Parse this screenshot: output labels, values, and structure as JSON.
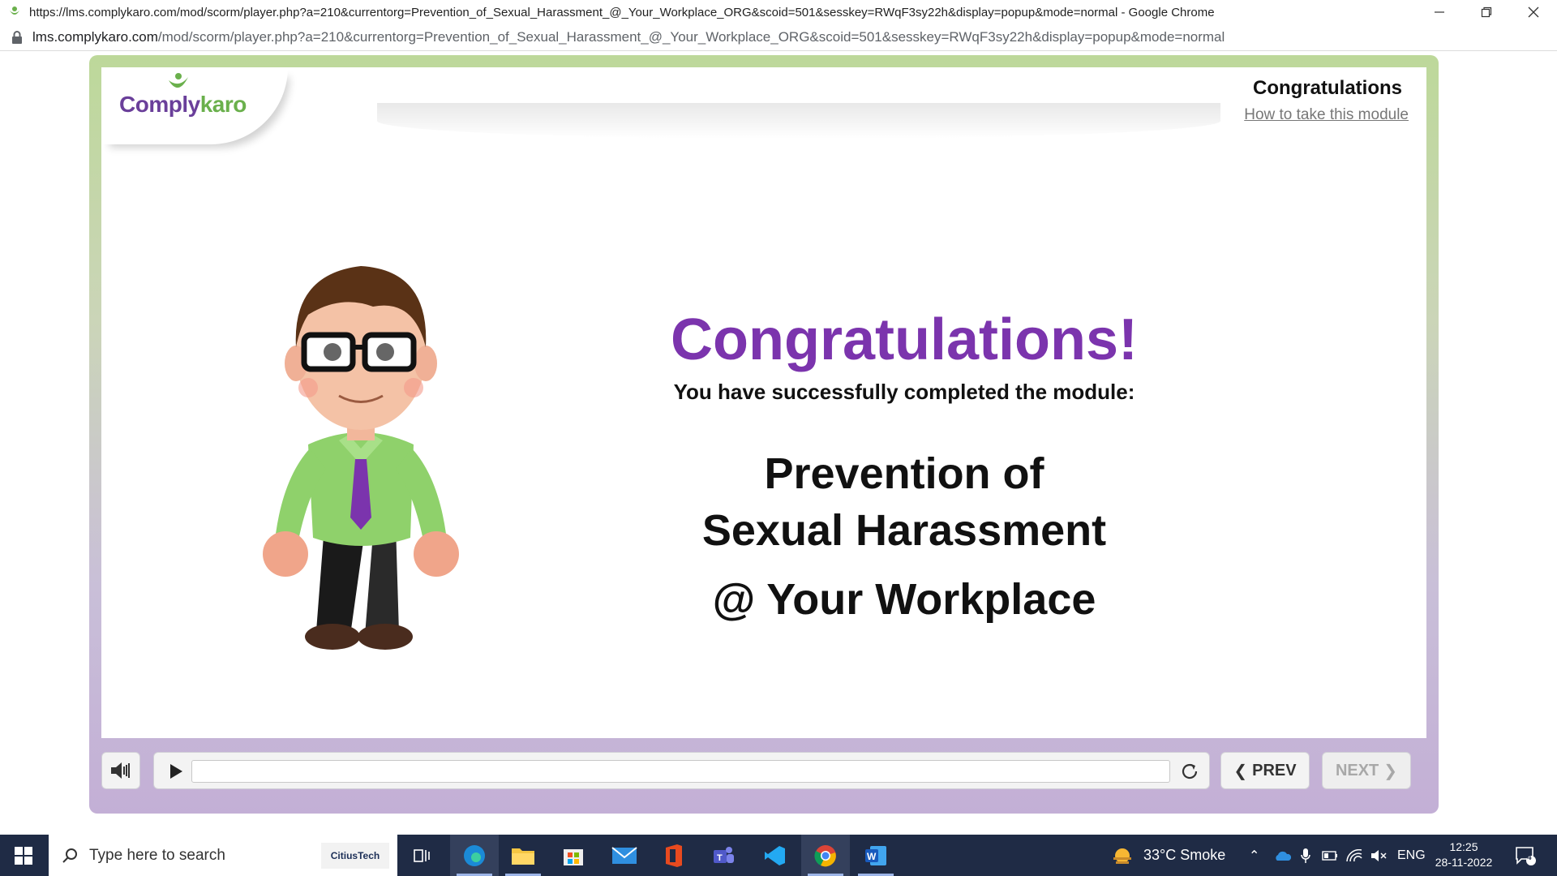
{
  "browser": {
    "window_title": "https://lms.complykaro.com/mod/scorm/player.php?a=210&currentorg=Prevention_of_Sexual_Harassment_@_Your_Workplace_ORG&scoid=501&sesskey=RWqF3sy22h&display=popup&mode=normal - Google Chrome",
    "url_host": "lms.complykaro.com",
    "url_path": "/mod/scorm/player.php?a=210&currentorg=Prevention_of_Sexual_Harassment_@_Your_Workplace_ORG&scoid=501&sesskey=RWqF3sy22h&display=popup&mode=normal"
  },
  "slide": {
    "logo_comply": "Comply",
    "logo_karo": "karo",
    "title": "Congratulations",
    "help_link": "How to take this module",
    "heading": "Congratulations!",
    "subheading": "You have successfully completed the module:",
    "module_line1": "Prevention of",
    "module_line2": "Sexual Harassment",
    "module_line3": "@ Your Workplace"
  },
  "controls": {
    "prev_label": "PREV",
    "next_label": "NEXT",
    "progress": 0
  },
  "taskbar": {
    "search_placeholder": "Type here to search",
    "search_brand": "CitiusTech",
    "weather": "33°C  Smoke",
    "language": "ENG",
    "time": "12:25",
    "date": "28-11-2022",
    "notification_count": "4"
  },
  "colors": {
    "heading": "#7b34ad",
    "logo_purple": "#6a3f9a",
    "logo_green": "#6ab04c",
    "frame_top": "#bdd89a",
    "frame_bottom": "#c3afd6",
    "taskbar": "#1f2b45"
  }
}
